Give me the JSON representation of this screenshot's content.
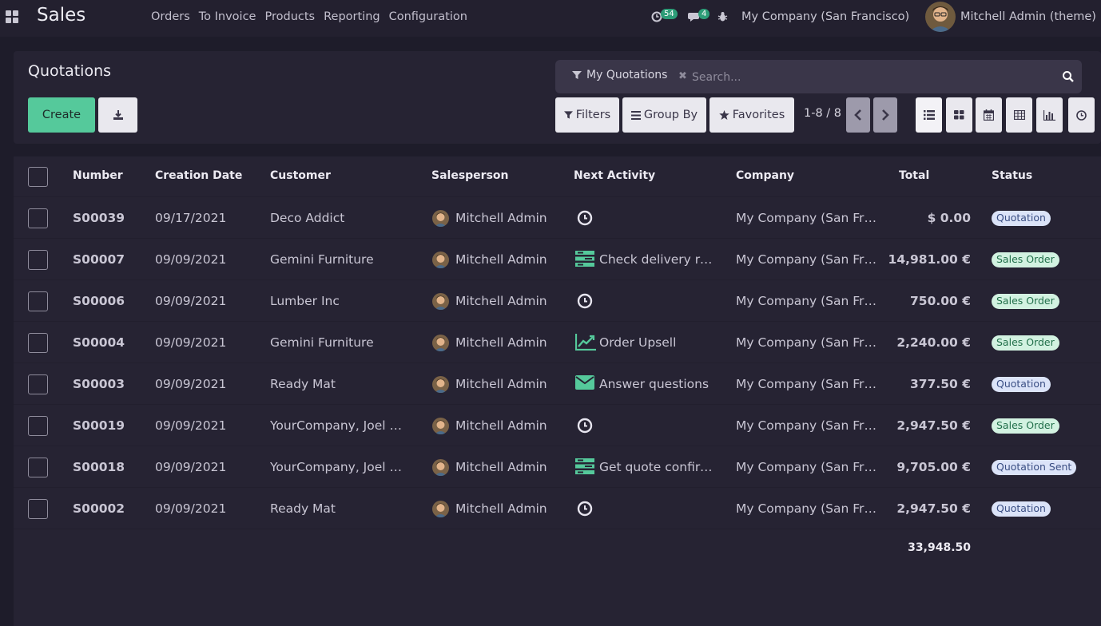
{
  "navbar": {
    "app_title": "Sales",
    "menu": [
      "Orders",
      "To Invoice",
      "Products",
      "Reporting",
      "Configuration"
    ],
    "activity_count": "54",
    "message_count": "4",
    "company": "My Company (San Francisco)",
    "user": "Mitchell Admin (theme)"
  },
  "control_panel": {
    "title": "Quotations",
    "create_label": "Create",
    "search": {
      "facet": "My Quotations",
      "placeholder": "Search..."
    },
    "filters_label": "Filters",
    "group_by_label": "Group By",
    "favorites_label": "Favorites",
    "pager": "1-8 / 8",
    "views": [
      "list-icon",
      "kanban-icon",
      "calendar-icon",
      "pivot-icon",
      "graph-icon",
      "activity-icon"
    ]
  },
  "table": {
    "columns": [
      "Number",
      "Creation Date",
      "Customer",
      "Salesperson",
      "Next Activity",
      "Company",
      "Total",
      "Status"
    ],
    "rows": [
      {
        "number": "S00039",
        "date": "09/17/2021",
        "customer": "Deco Addict",
        "salesperson": "Mitchell Admin",
        "activity": "",
        "activity_icon": "clock-icon",
        "company": "My Company (San Francisco)",
        "total": "$ 0.00",
        "status": "Quotation"
      },
      {
        "number": "S00007",
        "date": "09/09/2021",
        "customer": "Gemini Furniture",
        "salesperson": "Mitchell Admin",
        "activity": "Check delivery requirements",
        "activity_icon": "todo-icon",
        "company": "My Company (San Francisco)",
        "total": "14,981.00 €",
        "status": "Sales Order"
      },
      {
        "number": "S00006",
        "date": "09/09/2021",
        "customer": "Lumber Inc",
        "salesperson": "Mitchell Admin",
        "activity": "",
        "activity_icon": "clock-icon",
        "company": "My Company (San Francisco)",
        "total": "750.00 €",
        "status": "Sales Order"
      },
      {
        "number": "S00004",
        "date": "09/09/2021",
        "customer": "Gemini Furniture",
        "salesperson": "Mitchell Admin",
        "activity": "Order Upsell",
        "activity_icon": "upsell-icon",
        "company": "My Company (San Francisco)",
        "total": "2,240.00 €",
        "status": "Sales Order"
      },
      {
        "number": "S00003",
        "date": "09/09/2021",
        "customer": "Ready Mat",
        "salesperson": "Mitchell Admin",
        "activity": "Answer questions",
        "activity_icon": "email-icon",
        "company": "My Company (San Francisco)",
        "total": "377.50 €",
        "status": "Quotation"
      },
      {
        "number": "S00019",
        "date": "09/09/2021",
        "customer": "YourCompany, Joel Willis",
        "salesperson": "Mitchell Admin",
        "activity": "",
        "activity_icon": "clock-icon",
        "company": "My Company (San Francisco)",
        "total": "2,947.50 €",
        "status": "Sales Order"
      },
      {
        "number": "S00018",
        "date": "09/09/2021",
        "customer": "YourCompany, Joel Willis",
        "salesperson": "Mitchell Admin",
        "activity": "Get quote confirmation",
        "activity_icon": "todo-icon",
        "company": "My Company (San Francisco)",
        "total": "9,705.00 €",
        "status": "Quotation Sent"
      },
      {
        "number": "S00002",
        "date": "09/09/2021",
        "customer": "Ready Mat",
        "salesperson": "Mitchell Admin",
        "activity": "",
        "activity_icon": "clock-icon",
        "company": "My Company (San Francisco)",
        "total": "2,947.50 €",
        "status": "Quotation"
      }
    ],
    "grand_total": "33,948.50"
  },
  "colors": {
    "background": "#1e1c2a",
    "panel": "#262333",
    "accent_green": "#55c99b",
    "badge_quotation": "#dbe3f8",
    "badge_sales_order": "#d2f2e1"
  }
}
